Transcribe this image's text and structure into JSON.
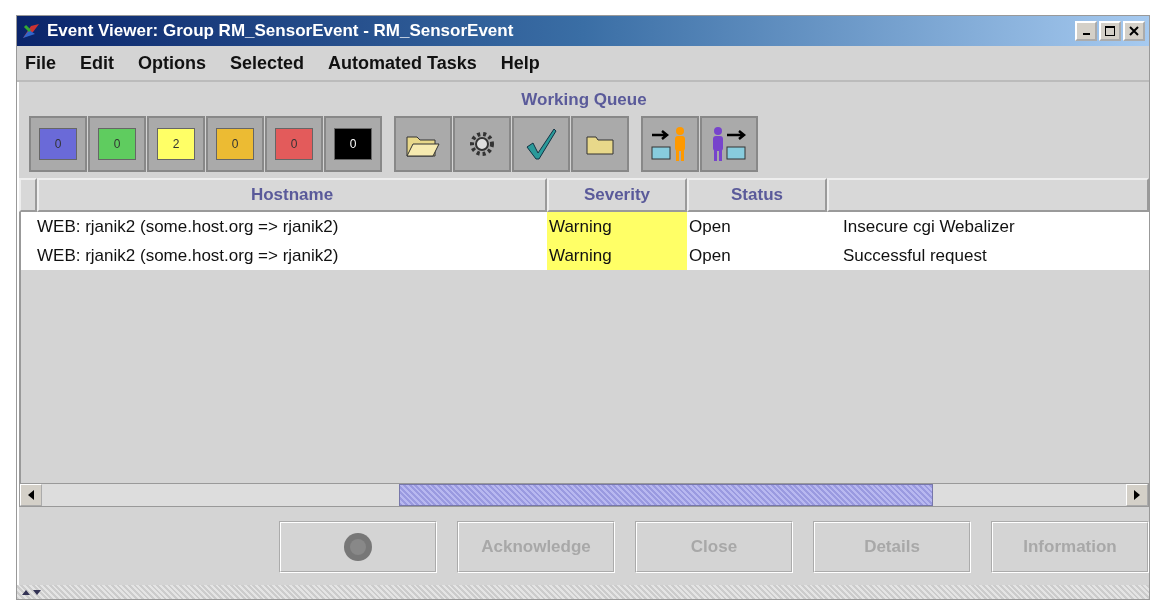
{
  "window": {
    "title": "Event Viewer: Group RM_SensorEvent - RM_SensorEvent"
  },
  "menu": [
    "File",
    "Edit",
    "Options",
    "Selected",
    "Automated Tasks",
    "Help"
  ],
  "queue_title": "Working Queue",
  "counters": [
    {
      "count": "0",
      "color": "#6a6ad8"
    },
    {
      "count": "0",
      "color": "#5fcc5f"
    },
    {
      "count": "2",
      "color": "#ffff66"
    },
    {
      "count": "0",
      "color": "#ecbb33"
    },
    {
      "count": "0",
      "color": "#e35b5b"
    },
    {
      "count": "0",
      "color": "#000000"
    }
  ],
  "table": {
    "columns": [
      "Hostname",
      "Severity",
      "Status"
    ],
    "rows": [
      {
        "hostname": "WEB: rjanik2 (some.host.org => rjanik2)",
        "severity": "Warning",
        "highlighted": true,
        "status": "Open",
        "column_4": "Insecure cgi Webalizer"
      },
      {
        "hostname": "WEB: rjanik2 (some.host.org => rjanik2)",
        "severity": "Warning",
        "highlighted": true,
        "status": "Open",
        "column_4": "Successful request"
      }
    ]
  },
  "buttons": [
    {
      "kind": "icon",
      "disabled": true
    },
    {
      "kind": "text",
      "label": "Acknowledge",
      "disabled": true
    },
    {
      "kind": "text",
      "label": "Close",
      "disabled": true
    },
    {
      "kind": "text",
      "label": "Details",
      "disabled": true
    },
    {
      "kind": "text",
      "label": "Information",
      "disabled": true
    }
  ]
}
